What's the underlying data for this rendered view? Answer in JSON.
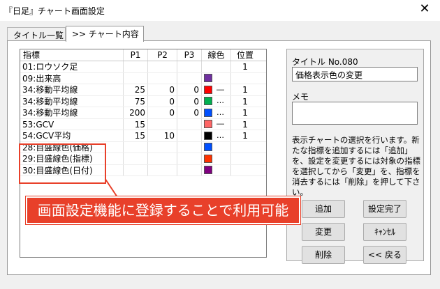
{
  "window": {
    "title": "『日足』チャート画面設定",
    "close_glyph": "✕"
  },
  "tabs": [
    {
      "label": "タイトル一覧"
    },
    {
      "label": ">> チャート内容"
    }
  ],
  "table": {
    "headers": {
      "name": "指標",
      "p1": "P1",
      "p2": "P2",
      "p3": "P3",
      "color": "線色",
      "pos": "位置"
    },
    "rows": [
      {
        "name": "01:ロウソク足",
        "p1": "",
        "p2": "",
        "p3": "",
        "color": "",
        "line": "",
        "pos": "1"
      },
      {
        "name": "09:出来高",
        "p1": "",
        "p2": "",
        "p3": "",
        "color": "#7030a0",
        "line": "",
        "pos": ""
      },
      {
        "name": "34:移動平均線",
        "p1": "25",
        "p2": "0",
        "p3": "0",
        "color": "#ff0000",
        "line": "―",
        "pos": "1"
      },
      {
        "name": "34:移動平均線",
        "p1": "75",
        "p2": "0",
        "p3": "0",
        "color": "#00b050",
        "line": "…",
        "pos": "1"
      },
      {
        "name": "34:移動平均線",
        "p1": "200",
        "p2": "0",
        "p3": "0",
        "color": "#0050ff",
        "line": "…",
        "pos": "1"
      },
      {
        "name": "53:GCV",
        "p1": "15",
        "p2": "",
        "p3": "",
        "color": "#ff6666",
        "line": "―",
        "pos": "1"
      },
      {
        "name": "54:GCV平均",
        "p1": "15",
        "p2": "10",
        "p3": "",
        "color": "#000000",
        "line": "…",
        "pos": "1"
      },
      {
        "name": "28:目盛線色(価格)",
        "p1": "",
        "p2": "",
        "p3": "",
        "color": "#0050ff",
        "line": "",
        "pos": ""
      },
      {
        "name": "29:目盛線色(指標)",
        "p1": "",
        "p2": "",
        "p3": "",
        "color": "#ff3300",
        "line": "",
        "pos": ""
      },
      {
        "name": "30:目盛線色(日付)",
        "p1": "",
        "p2": "",
        "p3": "",
        "color": "#800080",
        "line": "",
        "pos": ""
      }
    ]
  },
  "side": {
    "title_label": "タイトル No.080",
    "title_value": "価格表示色の変更",
    "memo_label": "メモ",
    "memo_value": "",
    "description": "表示チャートの選択を行います。新たな指標を追加するには「追加」を、設定を変更するには対象の指標を選択してから「変更」を、指標を消去するには「削除」を押して下さい。"
  },
  "buttons": {
    "add": "追加",
    "done": "設定完了",
    "change": "変更",
    "cancel": "ｷｬﾝｾﾙ",
    "delete": "削除",
    "back": "<< 戻る"
  },
  "annotation": {
    "callout": "画面設定機能に登録することで利用可能",
    "color": "#e8402a"
  }
}
